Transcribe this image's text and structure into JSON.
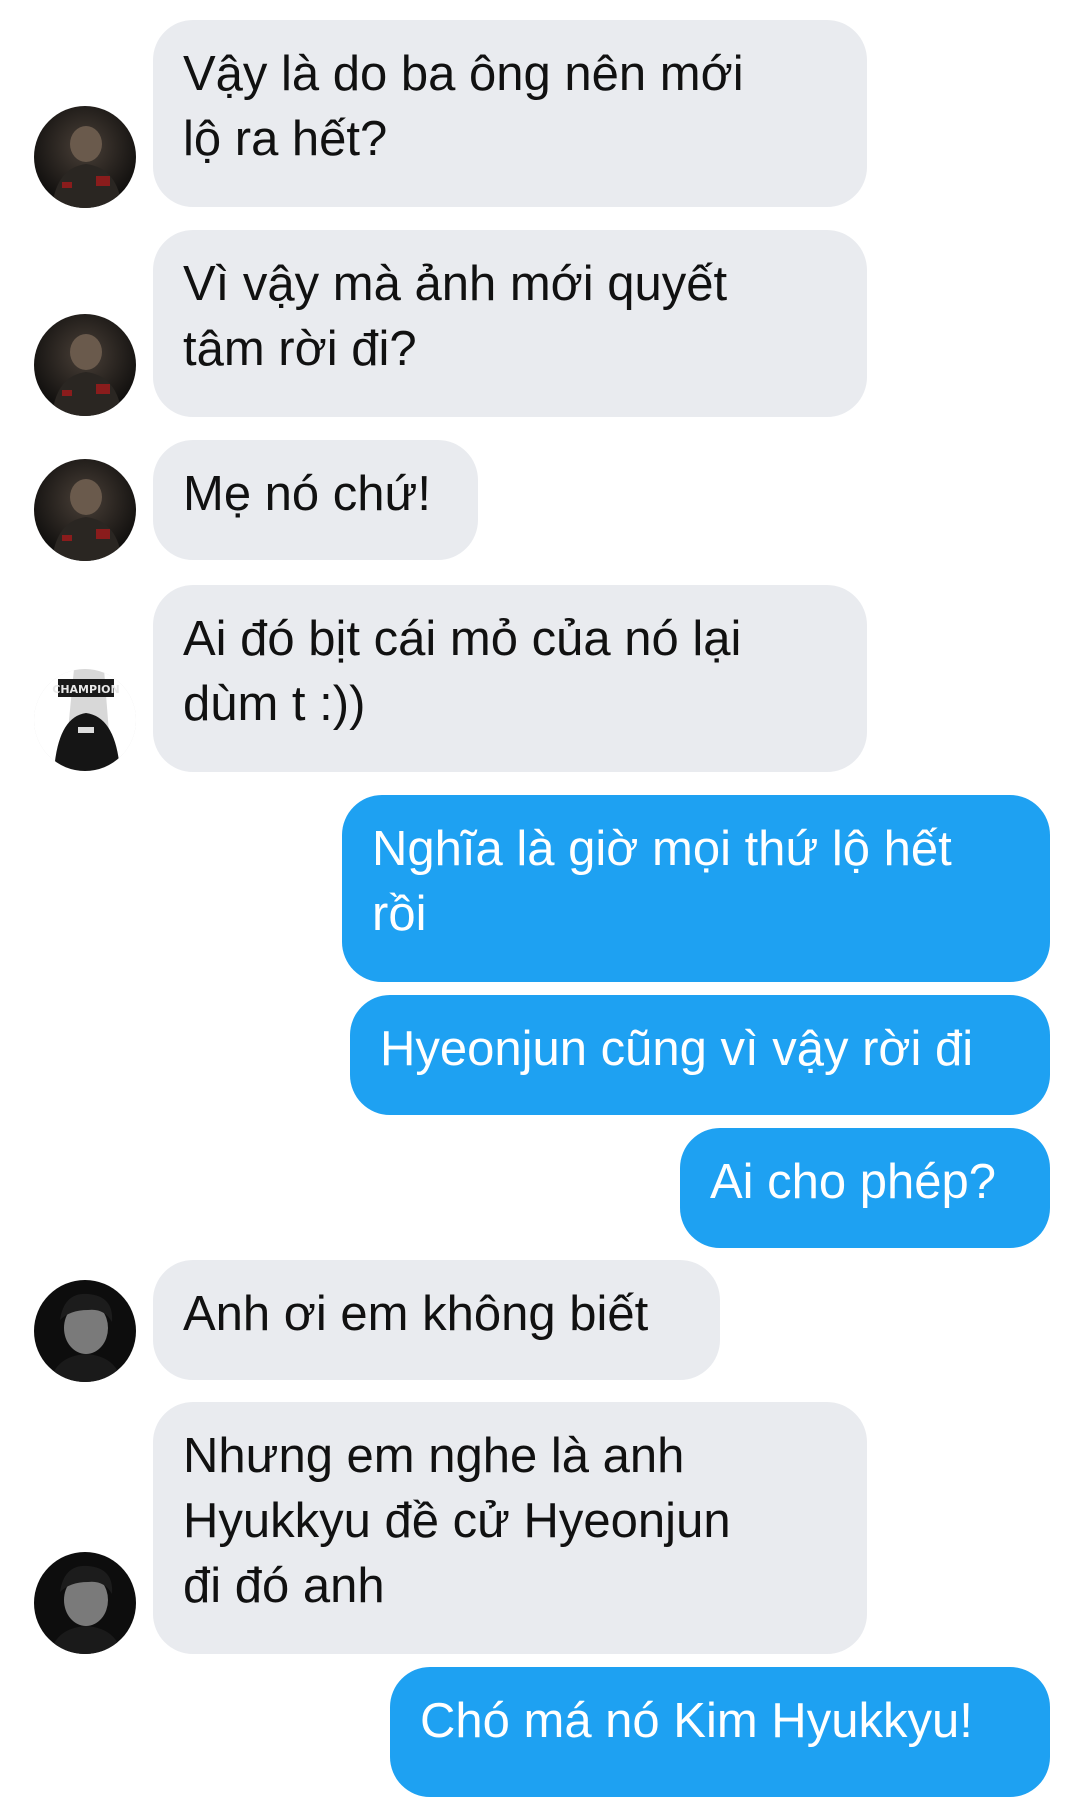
{
  "conversation": {
    "messages": [
      {
        "side": "in",
        "avatar": "player-dark-avatar",
        "text": "Vậy là do ba ông nên mới\nlộ ra hết?"
      },
      {
        "side": "in",
        "avatar": "player-dark-avatar",
        "text": "Vì vậy mà ảnh mới quyết\ntâm rời đi?"
      },
      {
        "side": "in",
        "avatar": "player-dark-avatar",
        "text": "Mẹ nó chứ!"
      },
      {
        "side": "in",
        "avatar": "champion-jacket-avatar",
        "text": "Ai đó bịt cái mỏ của nó lại\ndùm t :))"
      },
      {
        "side": "out",
        "avatar": "",
        "text": "Nghĩa là giờ mọi thứ lộ hết\nrồi"
      },
      {
        "side": "out",
        "avatar": "",
        "text": "Hyeonjun cũng vì vậy rời đi"
      },
      {
        "side": "out",
        "avatar": "",
        "text": "Ai cho phép?"
      },
      {
        "side": "in",
        "avatar": "young-man-bw-avatar",
        "text": "Anh ơi em không biết"
      },
      {
        "side": "in",
        "avatar": "young-man-bw-avatar",
        "text": "Nhưng em nghe là anh\nHyukkyu đề cử Hyeonjun\nđi đó anh"
      },
      {
        "side": "out",
        "avatar": "",
        "text": "Chó má nó Kim Hyukkyu!"
      }
    ]
  },
  "colors": {
    "incoming_bubble": "#e9ebef",
    "outgoing_bubble": "#1ea1f2",
    "incoming_text": "#111111",
    "outgoing_text": "#ffffff"
  }
}
